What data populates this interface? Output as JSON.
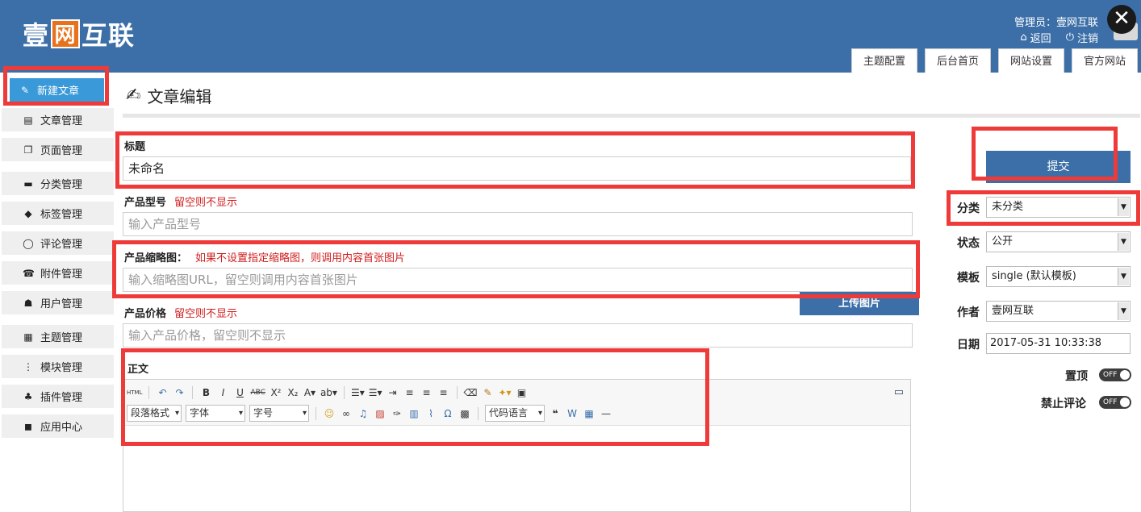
{
  "header": {
    "logo_prefix": "壹",
    "logo_boxed": "网",
    "logo_suffix": "互联",
    "admin_text": "管理员：壹网互联",
    "back_label": "返回",
    "logout_label": "注销",
    "close_glyph": "✕",
    "tabs": [
      {
        "label": "主题配置"
      },
      {
        "label": "后台首页"
      },
      {
        "label": "网站设置"
      },
      {
        "label": "官方网站"
      }
    ],
    "bg_color": "#3c6fa7",
    "logo_accent": "#e8711c"
  },
  "sidebar": {
    "items": [
      {
        "label": "新建文章",
        "icon": "edit-icon",
        "active": true
      },
      {
        "label": "文章管理",
        "icon": "document-icon"
      },
      {
        "label": "页面管理",
        "icon": "pages-icon"
      },
      {
        "label": "分类管理",
        "icon": "folder-icon"
      },
      {
        "label": "标签管理",
        "icon": "tag-icon"
      },
      {
        "label": "评论管理",
        "icon": "comment-icon"
      },
      {
        "label": "附件管理",
        "icon": "attachment-icon"
      },
      {
        "label": "用户管理",
        "icon": "user-icon"
      },
      {
        "label": "主题管理",
        "icon": "theme-icon"
      },
      {
        "label": "模块管理",
        "icon": "module-icon"
      },
      {
        "label": "插件管理",
        "icon": "plugin-icon"
      },
      {
        "label": "应用中心",
        "icon": "app-center-icon"
      }
    ],
    "active_color": "#3a99d8"
  },
  "main": {
    "page_title": "文章编辑",
    "title_field": {
      "label": "标题",
      "value": "未命名"
    },
    "model_field": {
      "label": "产品型号",
      "hint": "留空则不显示",
      "placeholder": "输入产品型号"
    },
    "thumb_field": {
      "label": "产品缩略图：",
      "hint": "如果不设置指定缩略图，则调用内容首张图片",
      "placeholder": "输入缩略图URL，留空则调用内容首张图片"
    },
    "upload_label": "上传图片",
    "price_field": {
      "label": "产品价格",
      "hint": "留空则不显示",
      "placeholder": "输入产品价格，留空则不显示"
    },
    "body_label": "正文",
    "editor": {
      "html_label": "HTML",
      "paragraph_select": "段落格式",
      "font_select": "字体",
      "size_select": "字号",
      "code_select": "代码语言"
    }
  },
  "right": {
    "submit_label": "提交",
    "category": {
      "label": "分类",
      "value": "未分类"
    },
    "status": {
      "label": "状态",
      "value": "公开"
    },
    "template": {
      "label": "模板",
      "value": "single (默认模板)"
    },
    "author": {
      "label": "作者",
      "value": "壹网互联"
    },
    "date": {
      "label": "日期",
      "value": "2017-05-31 10:33:38"
    },
    "pin": {
      "label": "置顶",
      "state": "OFF"
    },
    "no_comment": {
      "label": "禁止评论",
      "state": "OFF"
    }
  },
  "annotation_color": "#ef3a3a"
}
